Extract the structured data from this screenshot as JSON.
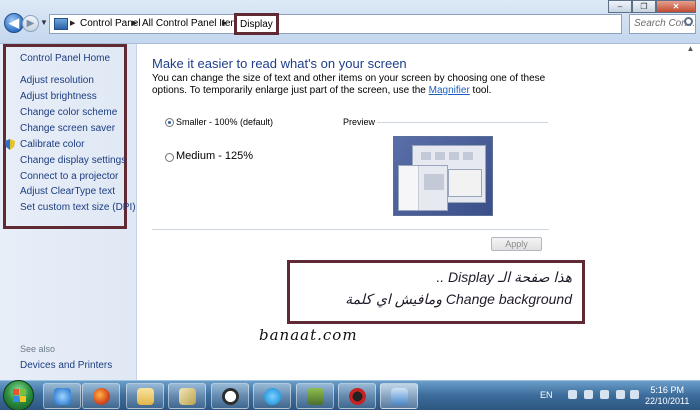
{
  "address_bar": {
    "breadcrumbs": [
      "Control Panel",
      "All Control Panel Items"
    ],
    "current": "Display",
    "search_placeholder": "Search Con..."
  },
  "sidebar": {
    "home": "Control Panel Home",
    "links": [
      "Adjust resolution",
      "Adjust brightness",
      "Change color scheme",
      "Change screen saver",
      "Calibrate color",
      "Change display settings",
      "Connect to a projector",
      "Adjust ClearType text",
      "Set custom text size (DPI)"
    ],
    "see_also": "See also",
    "see_also_links": [
      "Devices and Printers"
    ]
  },
  "main": {
    "title": "Make it easier to read what's on your screen",
    "desc_prefix": "You can change the size of text and other items on your screen by choosing one of these options. To temporarily enlarge just part of the screen, use the ",
    "desc_link": "Magnifier",
    "desc_suffix": " tool.",
    "options": [
      {
        "label": "Smaller - 100% (default)",
        "selected": true
      },
      {
        "label": "Medium - 125%",
        "selected": false
      }
    ],
    "preview_label": "Preview",
    "apply_label": "Apply"
  },
  "annotation": {
    "line1": "هذا صفحة الـ Display ..",
    "line2": "ومافيش اي كلمة Change background",
    "watermark": "banaat.com"
  },
  "taskbar": {
    "language": "EN",
    "time": "5:16 PM",
    "date": "22/10/2011",
    "buttons": [
      "internet-explorer",
      "firefox",
      "windows-explorer",
      "paint",
      "clock-app",
      "skype",
      "game",
      "media",
      "control-panel"
    ]
  },
  "colors": {
    "highlight_frame": "#5f2a34",
    "link": "#1c3c80",
    "title": "#1e3e8a"
  }
}
